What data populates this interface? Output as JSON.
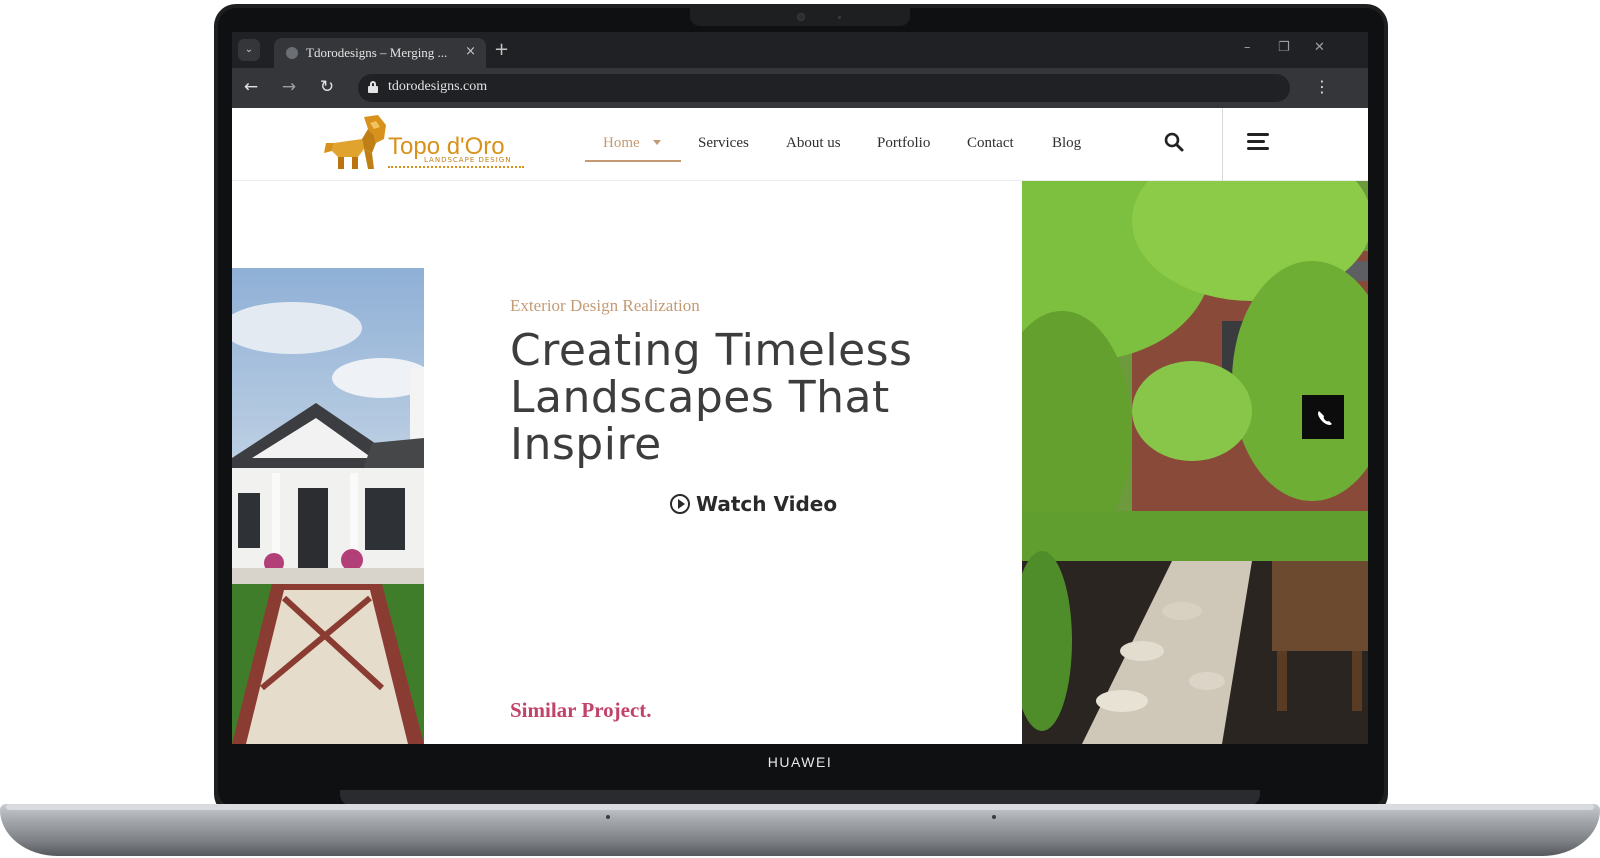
{
  "device": {
    "brand": "HUAWEI"
  },
  "browser": {
    "tab_title": "Tdorodesigns – Merging ...",
    "tab_close": "×",
    "new_tab": "+",
    "url": "tdorodesigns.com",
    "window_controls": {
      "minimize": "–",
      "restore": "❐",
      "close": "✕"
    },
    "icons": [
      "tab-search-icon",
      "back-arrow-icon",
      "forward-arrow-icon",
      "reload-icon",
      "lock-icon",
      "menu-kebab-icon"
    ]
  },
  "site": {
    "logo": {
      "name": "Topo d'Oro",
      "sub": "LANDSCAPE DESIGN"
    },
    "nav": [
      {
        "label": "Home",
        "active": true
      },
      {
        "label": "Services"
      },
      {
        "label": "About us"
      },
      {
        "label": "Portfolio"
      },
      {
        "label": "Contact"
      },
      {
        "label": "Blog"
      }
    ],
    "accent_color": "#c49a74",
    "highlight_color": "#c2426a"
  },
  "hero": {
    "eyebrow": "Exterior Design Realization",
    "headline_lines": [
      "Creating Timeless",
      "Landscapes That",
      "Inspire"
    ],
    "watch_label": "Watch Video",
    "similar_label": "Similar Project."
  }
}
